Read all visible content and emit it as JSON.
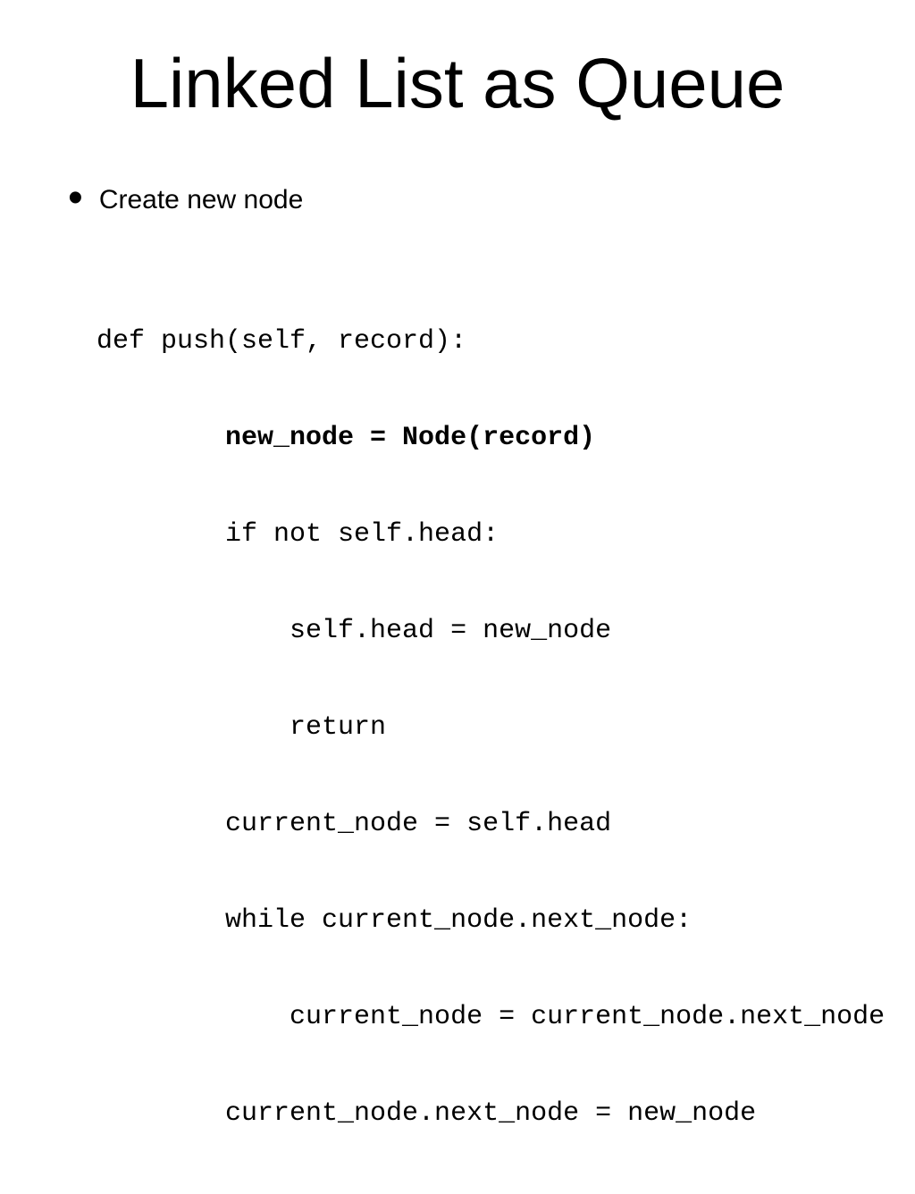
{
  "title": "Linked List as Queue",
  "bullet": "Create new node",
  "code": {
    "l1": "def push(self, record):",
    "l2": "        new_node = Node(record)",
    "l3": "        if not self.head:",
    "l4": "            self.head = new_node",
    "l5": "            return",
    "l6": "        current_node = self.head",
    "l7": "        while current_node.next_node:",
    "l8": "            current_node = current_node.next_node",
    "l9": "        current_node.next_node = new_node"
  }
}
